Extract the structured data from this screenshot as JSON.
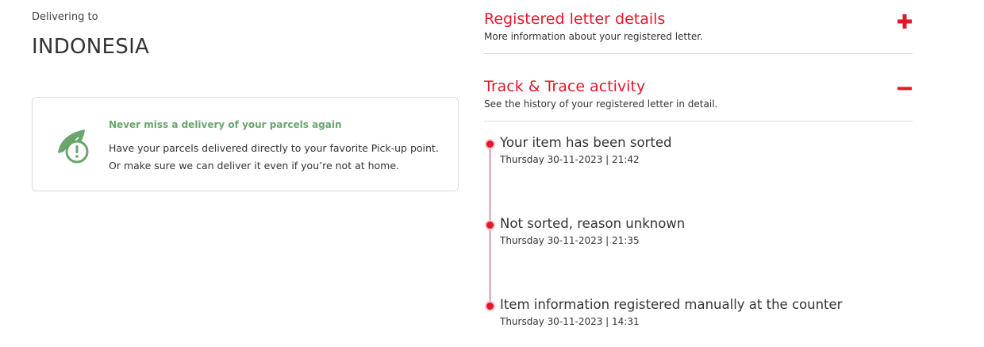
{
  "delivery": {
    "label": "Delivering to",
    "country": "INDONESIA"
  },
  "info_card": {
    "icon": "leaf-alert-icon",
    "title": "Never miss a delivery of your parcels again",
    "line1": "Have your parcels delivered directly to your favorite Pick-up point.",
    "line2": "Or make sure we can deliver it even if you’re not at home."
  },
  "sections": {
    "details": {
      "title": "Registered letter details",
      "subtitle": "More information about your registered letter.",
      "toggle_icon": "plus-icon"
    },
    "track": {
      "title": "Track & Trace activity",
      "subtitle": "See the history of your registered letter in detail.",
      "toggle_icon": "minus-icon"
    }
  },
  "events": [
    {
      "title": "Your item has been sorted",
      "time": "Thursday 30-11-2023 | 21:42"
    },
    {
      "title": "Not sorted, reason unknown",
      "time": "Thursday 30-11-2023 | 21:35"
    },
    {
      "title": "Item information registered manually at the counter",
      "time": "Thursday 30-11-2023 | 14:31"
    }
  ],
  "colors": {
    "accent": "#e4172a",
    "green": "#6aa56c",
    "timeline": "#b03a6b"
  }
}
